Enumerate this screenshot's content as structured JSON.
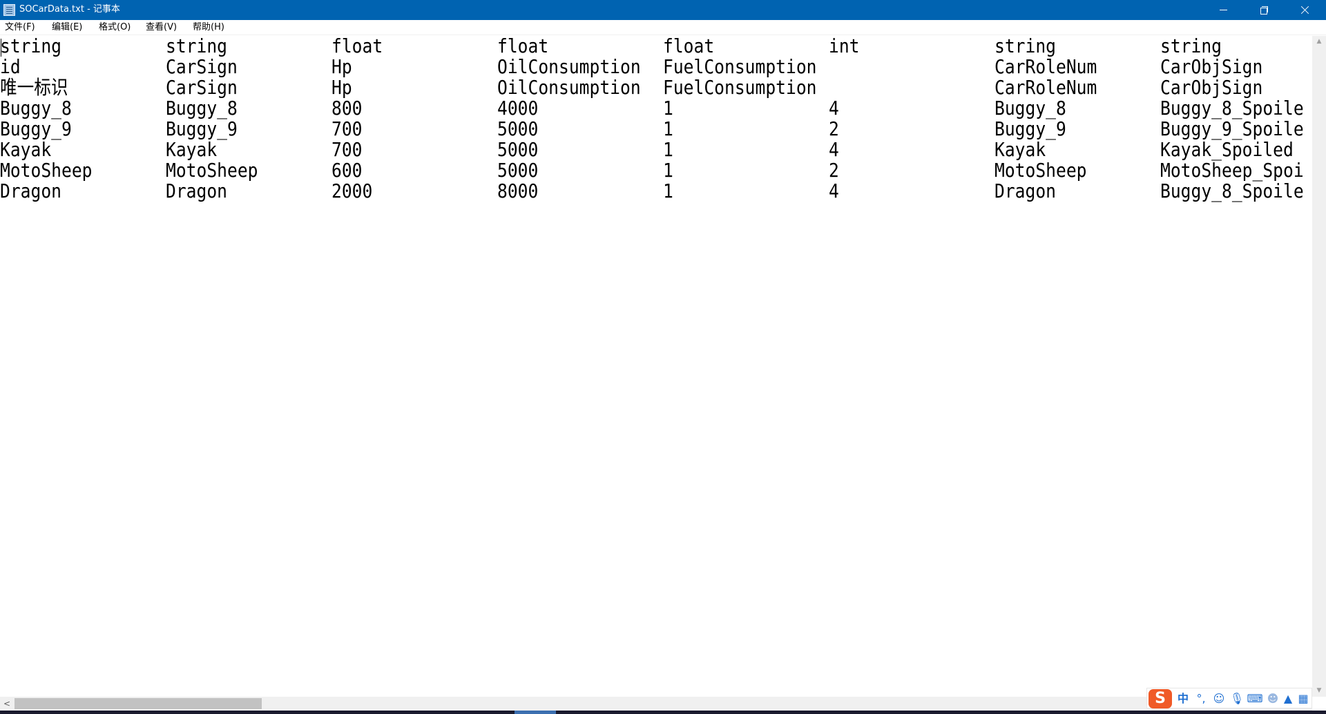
{
  "window": {
    "title": "SOCarData.txt - 记事本"
  },
  "menu": [
    "文件(F)",
    "编辑(E)",
    "格式(O)",
    "查看(V)",
    "帮助(H)"
  ],
  "editor": {
    "rows": [
      [
        "string",
        "string",
        "float",
        "float",
        "float",
        "int",
        "string",
        "string"
      ],
      [
        "id",
        "CarSign",
        "Hp",
        "OilConsumption",
        "FuelConsumption",
        "",
        "CarRoleNum",
        "CarObjSign"
      ],
      [
        "唯一标识",
        "CarSign",
        "Hp",
        "OilConsumption",
        "FuelConsumption",
        "",
        "CarRoleNum",
        "CarObjSign"
      ],
      [
        "Buggy_8",
        "Buggy_8",
        "800",
        "4000",
        "1",
        "4",
        "Buggy_8",
        "Buggy_8_Spoile"
      ],
      [
        "Buggy_9",
        "Buggy_9",
        "700",
        "5000",
        "1",
        "2",
        "Buggy_9",
        "Buggy_9_Spoile"
      ],
      [
        "Kayak",
        "Kayak",
        "700",
        "5000",
        "1",
        "4",
        "Kayak",
        "Kayak_Spoiled"
      ],
      [
        "MotoSheep",
        "MotoSheep",
        "600",
        "5000",
        "1",
        "2",
        "MotoSheep",
        "MotoSheep_Spoi"
      ],
      [
        "Dragon",
        "Dragon",
        "2000",
        "8000",
        "1",
        "4",
        "Dragon",
        "Buggy_8_Spoile"
      ]
    ]
  },
  "ime": {
    "logo": "S",
    "mode": "中",
    "punct": "°,",
    "icons": [
      "smiley-icon",
      "microphone-icon",
      "keyboard-icon",
      "user-icon",
      "shirt-icon",
      "grid-icon"
    ]
  },
  "colors": {
    "titlebar": "#0063b1",
    "ime_accent": "#1f6fd1",
    "ime_logo": "#f05a28"
  }
}
